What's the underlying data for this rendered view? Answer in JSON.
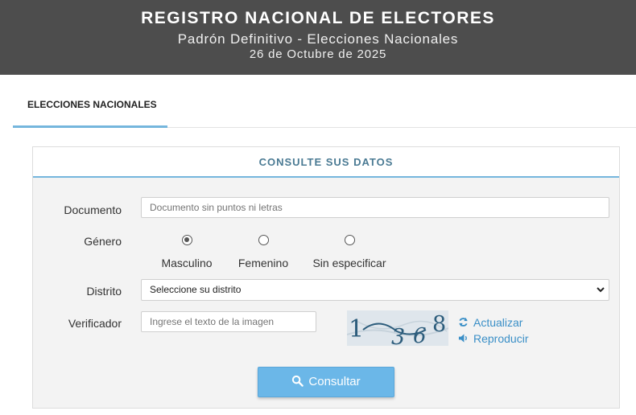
{
  "header": {
    "title": "REGISTRO NACIONAL DE ELECTORES",
    "subtitle": "Padrón Definitivo - Elecciones Nacionales",
    "date": "26 de Octubre de 2025"
  },
  "tabs": [
    {
      "label": "ELECCIONES NACIONALES",
      "active": true
    }
  ],
  "form": {
    "title": "CONSULTE SUS DATOS",
    "documento": {
      "label": "Documento",
      "placeholder": "Documento sin puntos ni letras",
      "value": ""
    },
    "genero": {
      "label": "Género",
      "options": [
        {
          "label": "Masculino",
          "checked": true
        },
        {
          "label": "Femenino",
          "checked": false
        },
        {
          "label": "Sin especificar",
          "checked": false
        }
      ]
    },
    "distrito": {
      "label": "Distrito",
      "selected": "Seleccione su distrito"
    },
    "verificador": {
      "label": "Verificador",
      "placeholder": "Ingrese el texto de la imagen",
      "captcha_text": "1368",
      "refresh_label": "Actualizar",
      "audio_label": "Reproducir"
    },
    "submit_label": "Consultar"
  },
  "icons": {
    "refresh": "refresh-icon",
    "audio": "speaker-icon",
    "search": "search-icon",
    "select": "chevron-down-icon"
  },
  "colors": {
    "header_bg": "#4d4d4d",
    "accent": "#75b6dd",
    "panel_title": "#4a7a93",
    "button": "#6bb7e8",
    "link": "#3a8fc7"
  }
}
